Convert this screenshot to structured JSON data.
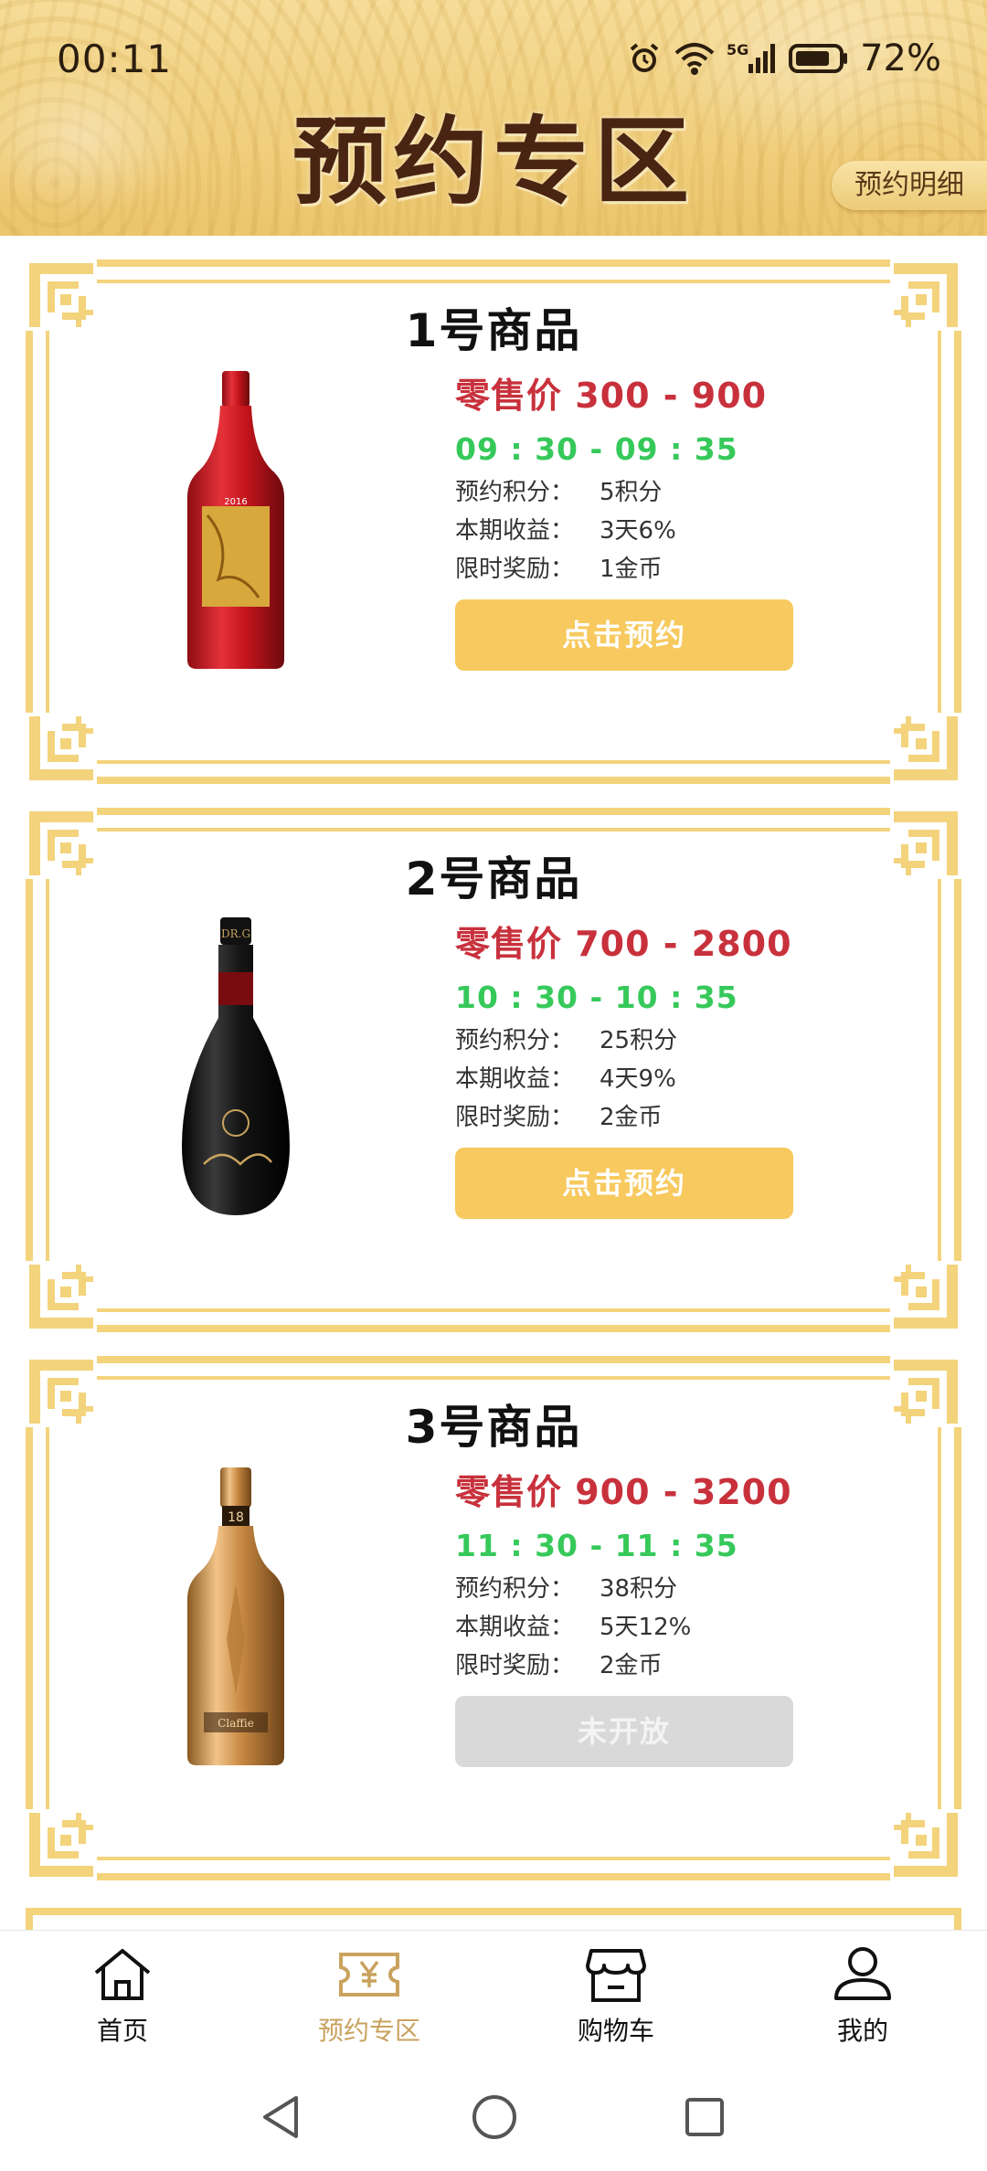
{
  "status_bar": {
    "time": "00:11",
    "battery": "72%",
    "network": "5G",
    "icons": [
      "alarm-icon",
      "wifi-icon",
      "signal-icon",
      "battery-icon"
    ]
  },
  "header": {
    "title": "预约专区",
    "detail_button": "预约明细"
  },
  "products": [
    {
      "title": "1号商品",
      "price": "零售价 300 - 900",
      "time": "09 : 30 - 09 : 35",
      "points_label": "预约积分：",
      "points_value": "5积分",
      "yield_label": "本期收益：",
      "yield_value": "3天6%",
      "reward_label": "限时奖励：",
      "reward_value": "1金币",
      "button": "点击预约",
      "button_enabled": true,
      "bottle": "red-wine-bottle"
    },
    {
      "title": "2号商品",
      "price": "零售价 700 - 2800",
      "time": "10 : 30 - 10 : 35",
      "points_label": "预约积分：",
      "points_value": "25积分",
      "yield_label": "本期收益：",
      "yield_value": "4天9%",
      "reward_label": "限时奖励：",
      "reward_value": "2金币",
      "button": "点击预约",
      "button_enabled": true,
      "bottle": "black-wine-bottle"
    },
    {
      "title": "3号商品",
      "price": "零售价 900 - 3200",
      "time": "11 : 30 - 11 : 35",
      "points_label": "预约积分：",
      "points_value": "38积分",
      "yield_label": "本期收益：",
      "yield_value": "5天12%",
      "reward_label": "限时奖励：",
      "reward_value": "2金币",
      "button": "未开放",
      "button_enabled": false,
      "bottle": "gold-wine-bottle"
    }
  ],
  "bottom_nav": [
    {
      "label": "首页",
      "icon": "home-icon",
      "active": false
    },
    {
      "label": "预约专区",
      "icon": "ticket-icon",
      "active": true
    },
    {
      "label": "购物车",
      "icon": "shop-icon",
      "active": false
    },
    {
      "label": "我的",
      "icon": "user-icon",
      "active": false
    }
  ],
  "system_nav": [
    "back-icon",
    "home-circle-icon",
    "recents-icon"
  ],
  "colors": {
    "price_red": "#c8313c",
    "time_green": "#36c95a",
    "button_gold": "#f7c95e",
    "frame_gold": "#f3d37c",
    "active_nav": "#c9a25e"
  }
}
